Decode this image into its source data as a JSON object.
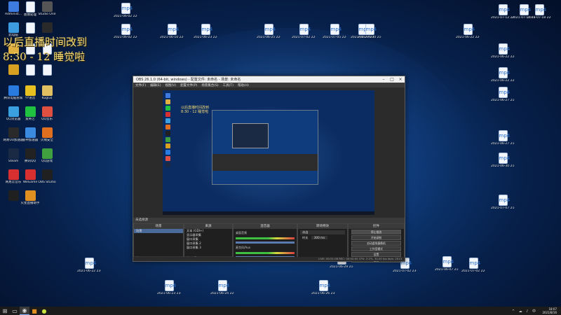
{
  "desktop": {
    "overlay_text": "以后直播时间改到",
    "overlay_text2": "8:30 - 12 睡觉啦",
    "left_icons": [
      {
        "label": "Administ...",
        "icon": "user-icon",
        "color": "#3d7be0"
      },
      {
        "label": "图像处理",
        "icon": "file-icon",
        "color": "#ffffff"
      },
      {
        "label": "Studio One",
        "icon": "studio-icon",
        "color": "#555555"
      },
      {
        "label": "此电脑",
        "icon": "computer-icon",
        "color": "#3d9be0"
      },
      {
        "label": "",
        "icon": "file-icon",
        "color": "#ffffff"
      },
      {
        "label": "",
        "icon": "app-icon",
        "color": "#2a2a2a"
      },
      {
        "label": "",
        "icon": "folder-icon",
        "color": "#e0b040"
      },
      {
        "label": "",
        "icon": "file-icon",
        "color": "#ffffff"
      },
      {
        "label": "",
        "icon": "file-icon",
        "color": "#ffffff"
      },
      {
        "label": "",
        "icon": "app-icon",
        "color": "#d8a020"
      },
      {
        "label": "",
        "icon": "file-icon",
        "color": "#ffffff"
      },
      {
        "label": "",
        "icon": "file-icon",
        "color": "#ffffff"
      },
      {
        "label": "腾讯电脑管家",
        "icon": "shield-icon",
        "color": "#2a7be0"
      },
      {
        "label": "YY语音",
        "icon": "yy-icon",
        "color": "#e8c020"
      },
      {
        "label": "KugGo",
        "icon": "music-icon",
        "color": "#e0c060"
      },
      {
        "label": "QQ浏览器",
        "icon": "browser-icon",
        "color": "#3aa0e0"
      },
      {
        "label": "爱奇艺",
        "icon": "iqiyi-icon",
        "color": "#20c040"
      },
      {
        "label": "QQ音乐",
        "icon": "qqmusic-icon",
        "color": "#e05040"
      },
      {
        "label": "网易UU加速器",
        "icon": "uu-icon",
        "color": "#2a2a2a"
      },
      {
        "label": "雷神加速器",
        "icon": "thunder-icon",
        "color": "#3a8ae0"
      },
      {
        "label": "火绒安全",
        "icon": "fire-icon",
        "color": "#e07020"
      },
      {
        "label": "Steam",
        "icon": "steam-icon",
        "color": "#1a2a44"
      },
      {
        "label": "腾讯QQ",
        "icon": "qq-icon",
        "color": "#222222"
      },
      {
        "label": "QQ游戏",
        "icon": "game-icon",
        "color": "#40a040"
      },
      {
        "label": "网易云音乐",
        "icon": "netease-icon",
        "color": "#d83030"
      },
      {
        "label": "WeGame",
        "icon": "wegame-icon",
        "color": "#d83030"
      },
      {
        "label": "OBS Studio",
        "icon": "obs-icon",
        "color": "#202020"
      },
      {
        "label": "",
        "icon": "app-icon",
        "color": "#202020"
      },
      {
        "label": "火星直播助手",
        "icon": "live-icon",
        "color": "#e09020"
      }
    ],
    "top_files": [
      {
        "label": "2021-06-02 22-14-17..."
      },
      {
        "label": "2021-06-02 22-13-35..."
      },
      {
        "label": "2021-06-10 22-12-12..."
      },
      {
        "label": "2021-06-23 22-13-20..."
      },
      {
        "label": "2021-06-25 22-13-29..."
      },
      {
        "label": "2021-07-02 22-14-05..."
      },
      {
        "label": "2021-07-05 22-13-46..."
      },
      {
        "label": "2021-06-27 21-52-40..."
      },
      {
        "label": "2021-06-30 21-41-22..."
      },
      {
        "label": "2021-06-22 22-04-46..."
      },
      {
        "label": "2021-07-12 22-14-29..."
      },
      {
        "label": "2021-07-15 14-46-38..."
      },
      {
        "label": "2021-07-18 22-13-31..."
      }
    ],
    "right_files": [
      {
        "label": "2021-06-22 22-14-20"
      },
      {
        "label": "2021-06-22 22-04-49"
      },
      {
        "label": "2021-06-27 21-21-36"
      },
      {
        "label": "2021-06-27 21-23-52"
      },
      {
        "label": "2021-06-30 21-41-42"
      },
      {
        "label": "2021-07-07 21-28-52"
      },
      {
        "label": "2021-06-07 21-27-14"
      }
    ],
    "bottom_files": [
      {
        "label": "2021-06-22 23-51-41"
      },
      {
        "label": "2021-06-23 23-40-33"
      },
      {
        "label": "2021-06-24 22-50-09"
      },
      {
        "label": "2021-06-26 23-52-02"
      },
      {
        "label": "2021-06-29 21-52-21"
      },
      {
        "label": "2021-07-02 23-49-51"
      },
      {
        "label": "2021-07-02 22-13-46"
      }
    ]
  },
  "obs": {
    "title": "OBS 26.1.0 (64-bit, windows) - 配置文件: 未命名 - 场景: 未命名",
    "menu": [
      "文件(F)",
      "编辑(E)",
      "视图(V)",
      "配置文件(P)",
      "场景集合(S)",
      "工具(T)",
      "帮助(H)"
    ],
    "scene_label": "未选择源",
    "docks": {
      "scenes": {
        "title": "场景",
        "items": [
          "场景"
        ]
      },
      "sources": {
        "title": "来源",
        "items": [
          "文本 (GDI+)",
          "显示器采集",
          "窗口采集",
          "窗口采集 2",
          "窗口采集 3"
        ]
      },
      "mixer": {
        "title": "混音器",
        "channels": [
          "桌面音频",
          "麦克风/Aux"
        ]
      },
      "transitions": {
        "title": "转场特效",
        "fade": "淡出",
        "duration_label": "时长",
        "duration": "300 ms"
      },
      "controls": {
        "title": "控件",
        "buttons": [
          "停止推流",
          "开始录制",
          "启动虚拟摄像机",
          "工作室模式",
          "设置",
          "退出"
        ]
      }
    },
    "status": "LIVE: 00:51:06   REC: 00:00:00   CPU: 3.2%, 30.00 fps   kb/s: 2513"
  },
  "taskbar": {
    "time": "18:07",
    "date": "2021/8/16"
  }
}
